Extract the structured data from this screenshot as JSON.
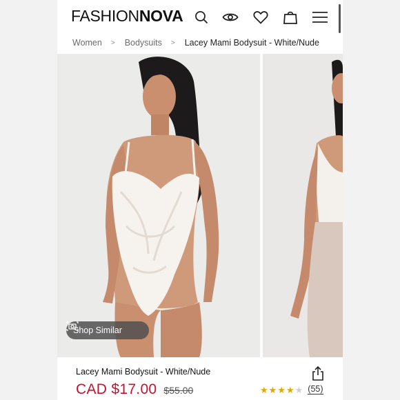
{
  "header": {
    "logo_part1": "FASHION",
    "logo_part2": "NOVA",
    "icons": [
      "search-icon",
      "eye-icon",
      "heart-icon",
      "shopping-bag-icon",
      "menu-icon"
    ]
  },
  "breadcrumb": {
    "items": [
      "Women",
      "Bodysuits",
      "Lacey Mami Bodysuit - White/Nude"
    ],
    "separator": ">"
  },
  "gallery": {
    "shop_similar_label": "Shop Similar"
  },
  "product": {
    "name": "Lacey Mami Bodysuit - White/Nude",
    "price": "CAD $17.00",
    "old_price": "$55.00",
    "rating": 4,
    "rating_max": 5,
    "review_count": "(55)"
  },
  "colors": {
    "price_red": "#c8102e",
    "star_gold": "#e0a800"
  }
}
